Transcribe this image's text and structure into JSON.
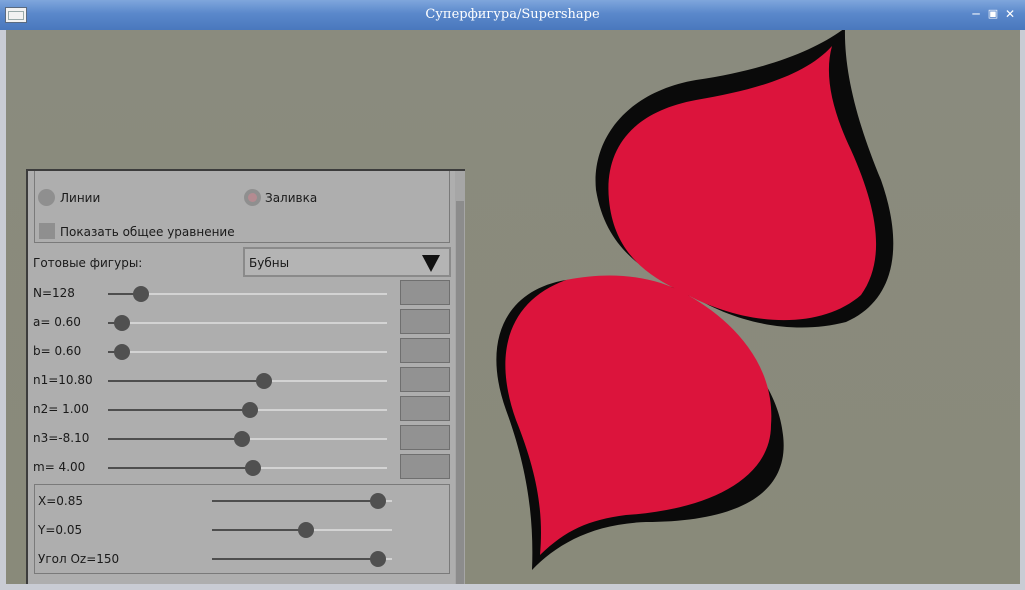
{
  "window": {
    "title": "Суперфигура/Supershape"
  },
  "shape": {
    "fill_color": "#dc143c",
    "shadow_color": "#0a0a0a",
    "background_color": "#898a7b"
  },
  "panel": {
    "render_mode": {
      "lines_label": "Линии",
      "fill_label": "Заливка",
      "selected": "fill"
    },
    "show_equation_label": "Показать общее уравнение",
    "presets": {
      "label": "Готовые фигуры:",
      "value": "Бубны"
    },
    "params": [
      {
        "label": "N=128",
        "fraction": 0.12
      },
      {
        "label": "a= 0.60",
        "fraction": 0.05
      },
      {
        "label": "b= 0.60",
        "fraction": 0.05
      },
      {
        "label": "n1=10.80",
        "fraction": 0.56
      },
      {
        "label": "n2= 1.00",
        "fraction": 0.51
      },
      {
        "label": "n3=-8.10",
        "fraction": 0.48
      },
      {
        "label": "m=  4.00",
        "fraction": 0.52
      }
    ],
    "transform": [
      {
        "label": "X=0.85",
        "fraction": 0.92
      },
      {
        "label": "Y=0.05",
        "fraction": 0.52
      },
      {
        "label": "Угол Oz=150",
        "fraction": 0.92
      }
    ]
  }
}
